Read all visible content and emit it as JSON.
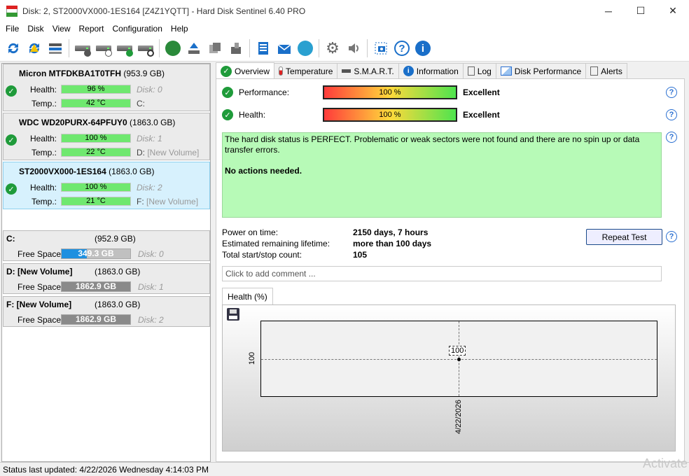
{
  "window": {
    "title": "Disk: 2, ST2000VX000-1ES164 [Z4Z1YQTT]  -  Hard Disk Sentinel 6.40 PRO",
    "minimize": "─",
    "maximize": "☐",
    "close": "✕"
  },
  "menu": {
    "file": "File",
    "disk": "Disk",
    "view": "View",
    "report": "Report",
    "configuration": "Configuration",
    "help": "Help"
  },
  "disks": [
    {
      "name": "Micron MTFDKBA1T0TFH",
      "size": "(953.9 GB)",
      "health_label": "Health:",
      "health": "96 %",
      "health_pct": 96,
      "disk_no": "Disk: 0",
      "temp_label": "Temp.:",
      "temp": "42 °C",
      "drive": "C:",
      "volume": ""
    },
    {
      "name": "WDC WD20PURX-64PFUY0",
      "size": "(1863.0 GB)",
      "health_label": "Health:",
      "health": "100 %",
      "health_pct": 100,
      "disk_no": "Disk: 1",
      "temp_label": "Temp.:",
      "temp": "22 °C",
      "drive": "D:",
      "volume": "[New Volume]"
    },
    {
      "name": "ST2000VX000-1ES164",
      "size": "(1863.0 GB)",
      "health_label": "Health:",
      "health": "100 %",
      "health_pct": 100,
      "disk_no": "Disk: 2",
      "temp_label": "Temp.:",
      "temp": "21 °C",
      "drive": "F:",
      "volume": "[New Volume]"
    }
  ],
  "volumes": [
    {
      "name": "C:",
      "size": "(952.9 GB)",
      "fs_label": "Free Space",
      "free": "349.3 GB",
      "free_pct": 37,
      "color": "#1e90e0",
      "disk": "Disk: 0"
    },
    {
      "name": "D: [New Volume]",
      "size": "(1863.0 GB)",
      "fs_label": "Free Space",
      "free": "1862.9 GB",
      "free_pct": 100,
      "color": "#8a8a8a",
      "disk": "Disk: 1"
    },
    {
      "name": "F: [New Volume]",
      "size": "(1863.0 GB)",
      "fs_label": "Free Space",
      "free": "1862.9 GB",
      "free_pct": 100,
      "color": "#8a8a8a",
      "disk": "Disk: 2"
    }
  ],
  "tabs": [
    "Overview",
    "Temperature",
    "S.M.A.R.T.",
    "Information",
    "Log",
    "Disk Performance",
    "Alerts"
  ],
  "overview": {
    "performance_label": "Performance:",
    "performance_value": "100 %",
    "performance_word": "Excellent",
    "health_label": "Health:",
    "health_value": "100 %",
    "health_word": "Excellent",
    "message": "The hard disk status is PERFECT. Problematic or weak sectors were not found and there are no spin up or data transfer errors.",
    "action": "No actions needed.",
    "power_on_label": "Power on time:",
    "power_on_value": "2150 days, 7 hours",
    "lifetime_label": "Estimated remaining lifetime:",
    "lifetime_value": "more than 100 days",
    "startstop_label": "Total start/stop count:",
    "startstop_value": "105",
    "repeat_test": "Repeat Test",
    "comment_placeholder": "Click to add comment ...",
    "graph_tab": "Health (%)"
  },
  "chart_data": {
    "type": "line",
    "x": [
      "4/22/2026"
    ],
    "series": [
      {
        "values": [
          100
        ]
      }
    ],
    "y_ticks": [
      "100"
    ],
    "data_labels": [
      "100"
    ]
  },
  "status": "Status last updated: 4/22/2026 Wednesday 4:14:03 PM",
  "watermark": "Activate",
  "icons": {
    "help": "?"
  }
}
